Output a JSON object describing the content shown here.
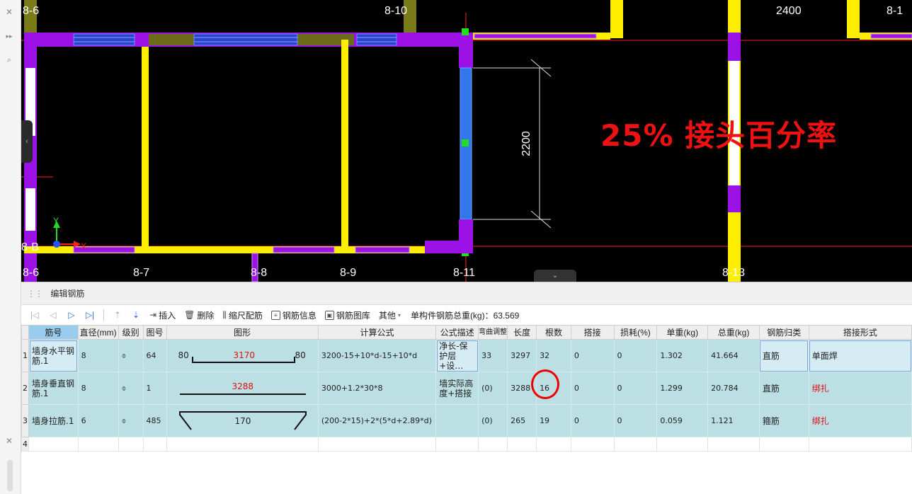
{
  "window": {
    "close_glyph_top": "✕",
    "close_glyph_bottom": "✕"
  },
  "viewport": {
    "axis_labels_top": [
      "8-6",
      "8-10",
      "2400",
      "8-1"
    ],
    "axis_labels_bottom": [
      "8-6",
      "8-7",
      "8-8",
      "8-9",
      "8-11",
      "8-13"
    ],
    "axis_label_left": "8-B",
    "dimension": "2200",
    "annotation": "25%  接头百分率",
    "ucs_y": "Y",
    "ucs_x": "X"
  },
  "panel": {
    "title": "编辑钢筋",
    "toolbar": {
      "insert": "插入",
      "delete": "删除",
      "scale_rebar": "缩尺配筋",
      "rebar_info": "钢筋信息",
      "rebar_library": "钢筋图库",
      "other": "其他",
      "total_weight": "单构件钢筋总重(kg)：63.569"
    },
    "columns": [
      "筋号",
      "直径(mm)",
      "级别",
      "图号",
      "图形",
      "计算公式",
      "公式描述",
      "弯曲调整",
      "长度",
      "根数",
      "搭接",
      "损耗(%)",
      "单重(kg)",
      "总重(kg)",
      "钢筋归类",
      "搭接形式"
    ],
    "grade_symbol": "⌽",
    "rows": [
      {
        "num": "1",
        "name": "墙身水平钢筋.1",
        "diameter": "8",
        "figure_no": "64",
        "shape": {
          "left": "80",
          "mid": "3170",
          "right": "80"
        },
        "formula": "3200-15+10*d-15+10*d",
        "desc": "净长-保护层+设…",
        "bend": "33",
        "length": "3297",
        "count": "32",
        "lap": "0",
        "loss": "0",
        "unit_weight": "1.302",
        "total_weight": "41.664",
        "category": "直筋",
        "lap_type": "单面焊"
      },
      {
        "num": "2",
        "name": "墙身垂直钢筋.1",
        "diameter": "8",
        "figure_no": "1",
        "shape": {
          "mid": "3288"
        },
        "formula": "3000+1.2*30*8",
        "desc": "墙实际高度+搭接",
        "bend": "(0)",
        "length": "3288",
        "count": "16",
        "lap": "0",
        "loss": "0",
        "unit_weight": "1.299",
        "total_weight": "20.784",
        "category": "直筋",
        "lap_type": "绑扎"
      },
      {
        "num": "3",
        "name": "墙身拉筋.1",
        "diameter": "6",
        "figure_no": "485",
        "shape": {
          "mid": "170"
        },
        "formula": "(200-2*15)+2*(5*d+2.89*d)",
        "desc": "",
        "bend": "(0)",
        "length": "265",
        "count": "19",
        "lap": "0",
        "loss": "0",
        "unit_weight": "0.059",
        "total_weight": "1.121",
        "category": "箍筋",
        "lap_type": "绑扎"
      },
      {
        "num": "4"
      }
    ]
  },
  "colors": {
    "wall_purple": "#9c11e6",
    "column_yellow": "#ffee00",
    "highlight_red": "#e01010",
    "grid_red": "#ff2020",
    "selected_blue": "#3377ee"
  }
}
